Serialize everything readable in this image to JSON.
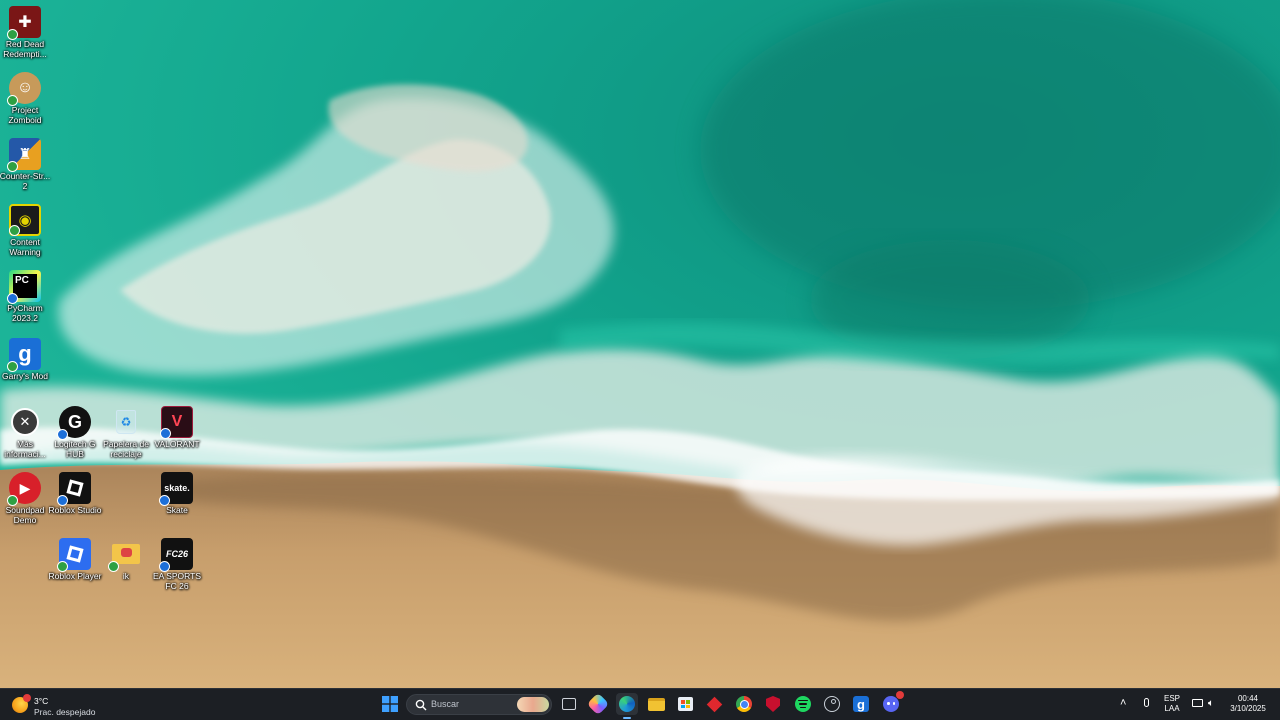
{
  "desktop": {
    "icons": [
      {
        "label": "Red Dead Redempti...",
        "icon": "red-dead-redemption-icon",
        "color": "#7a1616"
      },
      {
        "label": "Project Zomboid",
        "icon": "project-zomboid-icon",
        "color": "#b88744"
      },
      {
        "label": "Counter-Str... 2",
        "icon": "counter-strike-icon",
        "color": "#2458a8"
      },
      {
        "label": "Content Warning",
        "icon": "content-warning-icon",
        "color": "#1b1b1b"
      },
      {
        "label": "PyCharm 2023.2",
        "icon": "pycharm-icon",
        "color": "#111111",
        "text": "PC"
      },
      {
        "label": "Garry's Mod",
        "icon": "garrys-mod-icon",
        "color": "#1a6fd6",
        "text": "g"
      },
      {
        "label": "Más informaci...",
        "icon": "more-info-icon",
        "color": "#3a3a3a"
      },
      {
        "label": "Soundpad Demo",
        "icon": "soundpad-icon",
        "color": "#d8202a"
      },
      {
        "label": "Logitech G HUB",
        "icon": "logitech-g-hub-icon",
        "color": "#111111",
        "text": "G"
      },
      {
        "label": "Roblox Studio",
        "icon": "roblox-studio-icon",
        "color": "#111111"
      },
      {
        "label": "Roblox Player",
        "icon": "roblox-player-icon",
        "color": "#2d6df0"
      },
      {
        "label": "Papelera de reciclaje",
        "icon": "recycle-bin-icon",
        "color": "transparent"
      },
      {
        "label": "ik",
        "icon": "folder-icon",
        "color": "#f3c54a"
      },
      {
        "label": "VALORANT",
        "icon": "valorant-icon",
        "color": "#9e1b3d"
      },
      {
        "label": "Skate",
        "icon": "skate-icon",
        "color": "#111111",
        "text": "skate."
      },
      {
        "label": "EA SPORTS FC 26",
        "icon": "ea-sports-fc-icon",
        "color": "#111111",
        "text": "FC26"
      }
    ]
  },
  "taskbar": {
    "weather": {
      "temp": "3°C",
      "condition": "Prac. despejado",
      "icon": "weather-icon"
    },
    "search_placeholder": "Buscar",
    "apps": [
      {
        "name": "start-button",
        "icon": "windows-logo-icon",
        "color": "#3ea0ff"
      },
      {
        "name": "search"
      },
      {
        "name": "task-view-button",
        "icon": "task-view-icon",
        "color": "#cfd3da"
      },
      {
        "name": "copilot-app",
        "icon": "copilot-icon",
        "color": "#7a5cff"
      },
      {
        "name": "edge-app",
        "icon": "edge-icon",
        "color": "#1f9bd6"
      },
      {
        "name": "file-explorer-app",
        "icon": "folder-icon",
        "color": "#f1c232"
      },
      {
        "name": "microsoft-store-app",
        "icon": "store-icon",
        "color": "#e9eef5"
      },
      {
        "name": "red-diamond-app",
        "icon": "red-diamond-icon",
        "color": "#e0282e"
      },
      {
        "name": "chrome-app",
        "icon": "chrome-icon",
        "color": "#f2b23a"
      },
      {
        "name": "mcafee-app",
        "icon": "mcafee-shield-icon",
        "color": "#c8102e"
      },
      {
        "name": "spotify-app",
        "icon": "spotify-icon",
        "color": "#1ed760"
      },
      {
        "name": "steam-app",
        "icon": "steam-icon",
        "color": "#c9d0d8"
      },
      {
        "name": "garrys-mod-app",
        "icon": "garrys-mod-icon",
        "color": "#1a6fd6"
      },
      {
        "name": "discord-app",
        "icon": "discord-icon",
        "color": "#5865f2"
      }
    ],
    "tray": {
      "chevron": "˄",
      "lang_line1": "ESP",
      "lang_line2": "LAA",
      "time": "00:44",
      "date": "3/10/2025"
    }
  }
}
